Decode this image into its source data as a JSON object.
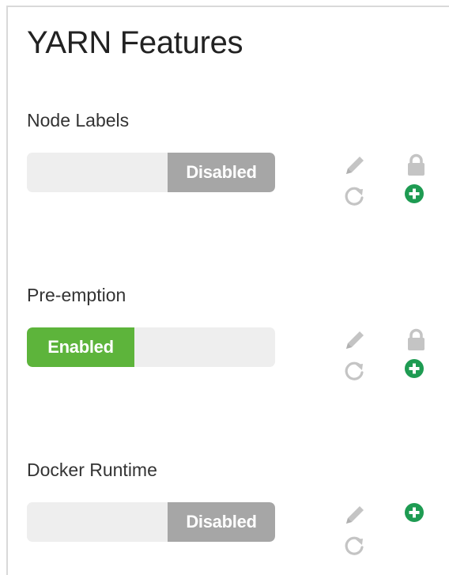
{
  "panel": {
    "title": "YARN Features"
  },
  "features": [
    {
      "label": "Node Labels",
      "state": "Disabled",
      "enabled": false,
      "icons": [
        "edit-pencil-icon",
        "refresh-icon",
        "lock-icon",
        "add-circle-icon"
      ]
    },
    {
      "label": "Pre-emption",
      "state": "Enabled",
      "enabled": true,
      "icons": [
        "edit-pencil-icon",
        "refresh-icon",
        "lock-icon",
        "add-circle-icon"
      ]
    },
    {
      "label": "Docker Runtime",
      "state": "Disabled",
      "enabled": false,
      "icons": [
        "edit-pencil-icon",
        "refresh-icon",
        "add-circle-icon"
      ]
    }
  ],
  "colors": {
    "enabled": "#5db43b",
    "disabled": "#a6a6a6",
    "track": "#eeeeee",
    "icon_gray": "#c4c4c4",
    "add_green": "#1e9b52"
  }
}
